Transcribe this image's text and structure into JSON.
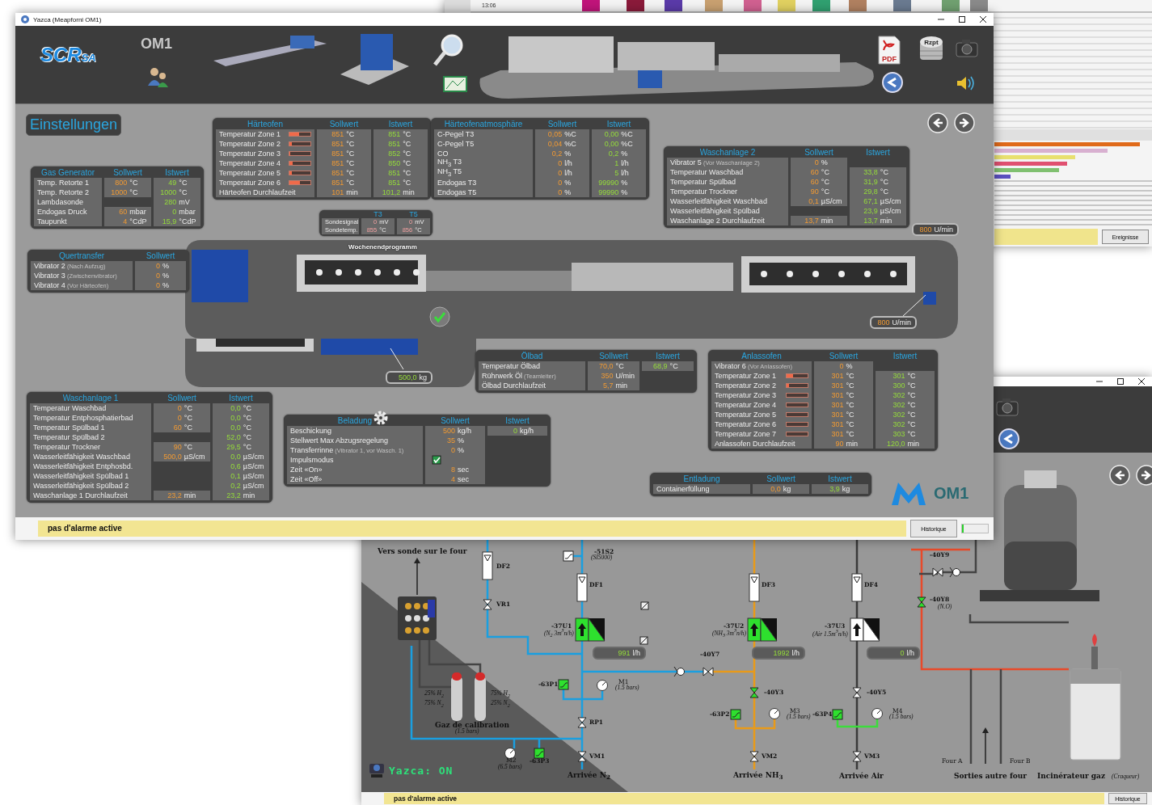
{
  "main_window": {
    "title": "Yazca (Meapforni OM1)",
    "header": {
      "logo": "SCR",
      "logo_suffix": "SA",
      "plant": "OM1",
      "pdf_label": "PDF",
      "database_label": "Rzpt"
    },
    "settings_button": "Einstellungen",
    "panels": [
      {
        "title": "Härteofen",
        "kind": "table",
        "columns": [
          "Sollwert",
          "Istwert"
        ],
        "rows": [
          {
            "label": "Temperatur Zone 1",
            "level": 0.45,
            "setpoint": {
              "value": "851",
              "unit": "°C"
            },
            "actual": {
              "value": "851",
              "unit": "°C"
            }
          },
          {
            "label": "Temperatur Zone 2",
            "level": 0.1,
            "setpoint": {
              "value": "851",
              "unit": "°C"
            },
            "actual": {
              "value": "851",
              "unit": "°C"
            }
          },
          {
            "label": "Temperatur Zone 3",
            "level": 0.03,
            "setpoint": {
              "value": "851",
              "unit": "°C"
            },
            "actual": {
              "value": "852",
              "unit": "°C"
            }
          },
          {
            "label": "Temperatur Zone 4",
            "level": 0.15,
            "setpoint": {
              "value": "851",
              "unit": "°C"
            },
            "actual": {
              "value": "850",
              "unit": "°C"
            }
          },
          {
            "label": "Temperatur Zone 5",
            "level": 0.1,
            "setpoint": {
              "value": "851",
              "unit": "°C"
            },
            "actual": {
              "value": "851",
              "unit": "°C"
            }
          },
          {
            "label": "Temperatur Zone 6",
            "level": 0.5,
            "setpoint": {
              "value": "851",
              "unit": "°C"
            },
            "actual": {
              "value": "851",
              "unit": "°C"
            }
          },
          {
            "label": "Härteofen Durchlaufzeit",
            "setpoint": {
              "value": "101",
              "unit": "min"
            },
            "actual": {
              "value": "101,2",
              "unit": "min"
            }
          }
        ]
      },
      {
        "title": "Härteofenatmosphäre",
        "kind": "table",
        "columns": [
          "Sollwert",
          "Istwert"
        ],
        "rows": [
          {
            "label": "C-Pegel T3",
            "setpoint": {
              "value": "0,05",
              "unit": "%C"
            },
            "actual": {
              "value": "0,00",
              "unit": "%C"
            }
          },
          {
            "label": "C-Pegel T5",
            "setpoint": {
              "value": "0,04",
              "unit": "%C"
            },
            "actual": {
              "value": "0,00",
              "unit": "%C"
            }
          },
          {
            "label": "CO",
            "setpoint": {
              "value": "0,2",
              "unit": "%"
            },
            "actual": {
              "value": "0,2",
              "unit": "%"
            }
          },
          {
            "label": "NH$_{3}$ T3",
            "setpoint": {
              "value": "0",
              "unit": "l/h"
            },
            "actual": {
              "value": "1",
              "unit": "l/h"
            }
          },
          {
            "label": "NH$_{3}$ T5",
            "setpoint": {
              "value": "0",
              "unit": "l/h"
            },
            "actual": {
              "value": "5",
              "unit": "l/h"
            }
          },
          {
            "label": "Endogas T3",
            "setpoint": {
              "value": "0",
              "unit": "%"
            },
            "actual": {
              "value": "99990",
              "unit": "%"
            }
          },
          {
            "label": "Endogas T5",
            "setpoint": {
              "value": "0",
              "unit": "%"
            },
            "actual": {
              "value": "99990",
              "unit": "%"
            }
          }
        ]
      },
      {
        "title": "Gas Generator",
        "kind": "table",
        "columns": [
          "Sollwert",
          "Istwert"
        ],
        "rows": [
          {
            "label": "Temp. Retorte 1",
            "setpoint": {
              "value": "800",
              "unit": "°C"
            },
            "actual": {
              "value": "49",
              "unit": "°C"
            }
          },
          {
            "label": "Temp. Retorte 2",
            "setpoint": {
              "value": "1000",
              "unit": "°C"
            },
            "actual": {
              "value": "1000",
              "unit": "°C"
            }
          },
          {
            "label": "Lambdasonde",
            "actual": {
              "value": "280",
              "unit": "mV"
            }
          },
          {
            "label": "Endogas Druck",
            "setpoint": {
              "value": "60",
              "unit": "mbar"
            },
            "actual": {
              "value": "0",
              "unit": "mbar"
            }
          },
          {
            "label": "Taupunkt",
            "setpoint": {
              "value": "4",
              "unit": "°CdP"
            },
            "actual": {
              "value": "15,9",
              "unit": "°CdP"
            }
          }
        ]
      },
      {
        "title": "Waschanlage 2",
        "kind": "table",
        "columns": [
          "Sollwert",
          "Istwert"
        ],
        "rows": [
          {
            "label": "Vibrator 5",
            "note": "(Vor Waschanlage 2)",
            "setpoint": {
              "value": "0",
              "unit": "%"
            }
          },
          {
            "label": "Temperatur Waschbad",
            "setpoint": {
              "value": "60",
              "unit": "°C"
            },
            "actual": {
              "value": "33,8",
              "unit": "°C"
            }
          },
          {
            "label": "Temperatur Spülbad",
            "setpoint": {
              "value": "60",
              "unit": "°C"
            },
            "actual": {
              "value": "31,9",
              "unit": "°C"
            }
          },
          {
            "label": "Temperatur Trockner",
            "setpoint": {
              "value": "90",
              "unit": "°C"
            },
            "actual": {
              "value": "29,8",
              "unit": "°C"
            }
          },
          {
            "label": "Wasserleitfähigkeit Waschbad",
            "setpoint": {
              "value": "0,1",
              "unit": "µS/cm"
            },
            "actual": {
              "value": "67,1",
              "unit": "µS/cm"
            }
          },
          {
            "label": "Wasserleitfähigkeit Spülbad",
            "actual": {
              "value": "23,9",
              "unit": "µS/cm"
            }
          },
          {
            "label": "Waschanlage 2 Durchlaufzeit",
            "setpoint": {
              "value": "13,7",
              "unit": "min"
            },
            "actual": {
              "value": "13,7",
              "unit": "min"
            }
          }
        ]
      },
      {
        "kind": "probe",
        "columns": [
          "T3",
          "T5"
        ],
        "rows": [
          {
            "label": "Sondesignal",
            "t3": {
              "value": "0",
              "unit": "mV"
            },
            "t5": {
              "value": "0",
              "unit": "mV"
            }
          },
          {
            "label": "Sondetemp.",
            "t3": {
              "value": "855",
              "unit": "°C"
            },
            "t5": {
              "value": "856",
              "unit": "°C"
            }
          }
        ]
      },
      {
        "title": "Quertransfer",
        "kind": "table",
        "columns": [
          "Sollwert"
        ],
        "rows": [
          {
            "label": "Vibrator 2",
            "note": "(Nach Aufzug)",
            "setpoint": {
              "value": "0",
              "unit": "%"
            }
          },
          {
            "label": "Vibrator 3",
            "note": "(Zwischenvibrator)",
            "setpoint": {
              "value": "0",
              "unit": "%"
            }
          },
          {
            "label": "Vibrator 4",
            "note": "(Vor Härteofen)",
            "setpoint": {
              "value": "0",
              "unit": "%"
            }
          }
        ]
      },
      {
        "title": "Ölbad",
        "kind": "table",
        "columns": [
          "Sollwert",
          "Istwert"
        ],
        "rows": [
          {
            "label": "Temperatur Ölbad",
            "setpoint": {
              "value": "70,0",
              "unit": "°C"
            },
            "actual": {
              "value": "68,9",
              "unit": "°C"
            }
          },
          {
            "label": "Rührwerk Öl",
            "note": "(Teamleiter)",
            "setpoint": {
              "value": "350",
              "unit": "U/min"
            }
          },
          {
            "label": "Ölbad Durchlaufzeit",
            "setpoint": {
              "value": "5,7",
              "unit": "min"
            }
          }
        ]
      },
      {
        "title": "Anlassofen",
        "kind": "table",
        "columns": [
          "Sollwert",
          "Istwert"
        ],
        "rows": [
          {
            "label": "Vibrator 6",
            "note": "(Vor Anlassofen)",
            "setpoint": {
              "value": "0",
              "unit": "%"
            }
          },
          {
            "label": "Temperatur Zone 1",
            "level": 0.3,
            "setpoint": {
              "value": "301",
              "unit": "°C"
            },
            "actual": {
              "value": "301",
              "unit": "°C"
            }
          },
          {
            "label": "Temperatur Zone 2",
            "level": 0.12,
            "setpoint": {
              "value": "301",
              "unit": "°C"
            },
            "actual": {
              "value": "300",
              "unit": "°C"
            }
          },
          {
            "label": "Temperatur Zone 3",
            "level": 0,
            "setpoint": {
              "value": "301",
              "unit": "°C"
            },
            "actual": {
              "value": "302",
              "unit": "°C"
            }
          },
          {
            "label": "Temperatur Zone 4",
            "level": 0,
            "setpoint": {
              "value": "301",
              "unit": "°C"
            },
            "actual": {
              "value": "302",
              "unit": "°C"
            }
          },
          {
            "label": "Temperatur Zone 5",
            "level": 0,
            "setpoint": {
              "value": "301",
              "unit": "°C"
            },
            "actual": {
              "value": "302",
              "unit": "°C"
            }
          },
          {
            "label": "Temperatur Zone 6",
            "level": 0,
            "setpoint": {
              "value": "301",
              "unit": "°C"
            },
            "actual": {
              "value": "302",
              "unit": "°C"
            }
          },
          {
            "label": "Temperatur Zone 7",
            "level": 0,
            "setpoint": {
              "value": "301",
              "unit": "°C"
            },
            "actual": {
              "value": "303",
              "unit": "°C"
            }
          },
          {
            "label": "Anlassofen Durchlaufzeit",
            "setpoint": {
              "value": "90",
              "unit": "min"
            },
            "actual": {
              "value": "120,0",
              "unit": "min"
            }
          }
        ]
      },
      {
        "title": "Waschanlage 1",
        "kind": "table",
        "columns": [
          "Sollwert",
          "Istwert"
        ],
        "rows": [
          {
            "label": "Temperatur Waschbad",
            "setpoint": {
              "value": "0",
              "unit": "°C"
            },
            "actual": {
              "value": "0,0",
              "unit": "°C"
            }
          },
          {
            "label": "Temperatur Entphosphatierbad",
            "setpoint": {
              "value": "0",
              "unit": "°C"
            },
            "actual": {
              "value": "0,0",
              "unit": "°C"
            }
          },
          {
            "label": "Temperatur Spülbad 1",
            "setpoint": {
              "value": "60",
              "unit": "°C"
            },
            "actual": {
              "value": "0,0",
              "unit": "°C"
            }
          },
          {
            "label": "Temperatur Spülbad 2",
            "actual": {
              "value": "52,0",
              "unit": "°C"
            }
          },
          {
            "label": "Temperatur Trockner",
            "setpoint": {
              "value": "90",
              "unit": "°C"
            },
            "actual": {
              "value": "29,5",
              "unit": "°C"
            }
          },
          {
            "label": "Wasserleitfähigkeit Waschbad",
            "setpoint": {
              "value": "500,0",
              "unit": "µS/cm"
            },
            "actual": {
              "value": "0,0",
              "unit": "µS/cm"
            }
          },
          {
            "label": "Wasserleitfähigkeit Entphosbd.",
            "actual": {
              "value": "0,6",
              "unit": "µS/cm"
            }
          },
          {
            "label": "Wasserleitfähigkeit Spülbad 1",
            "actual": {
              "value": "0,1",
              "unit": "µS/cm"
            }
          },
          {
            "label": "Wasserleitfähigkeit Spülbad 2",
            "actual": {
              "value": "0,2",
              "unit": "µS/cm"
            }
          },
          {
            "label": "Waschanlage 1 Durchlaufzeit",
            "setpoint": {
              "value": "23,2",
              "unit": "min"
            },
            "actual": {
              "value": "23,2",
              "unit": "min"
            }
          }
        ]
      },
      {
        "title": "Beladung",
        "kind": "table",
        "columns": [
          "Sollwert",
          "Istwert"
        ],
        "rows": [
          {
            "label": "Beschickung",
            "kind": "value",
            "setpoint": {
              "value": "500",
              "unit": "kg/h"
            },
            "actual": {
              "value": "0",
              "unit": "kg/h"
            }
          },
          {
            "label": "Stellwert Max Abzugsregelung",
            "kind": "value",
            "setpoint": {
              "value": "35",
              "unit": "%"
            }
          },
          {
            "label": "Transferrinne",
            "kind": "value",
            "note": "(Vibrator 1, vor Wasch. 1)",
            "setpoint": {
              "value": "0",
              "unit": "%"
            }
          },
          {
            "label": "Impulsmodus",
            "kind": "checkbox",
            "checked": true
          },
          {
            "label": "Zeit «On»",
            "kind": "value",
            "setpoint": {
              "value": "8",
              "unit": "sec"
            }
          },
          {
            "label": "Zeit «Off»",
            "kind": "value",
            "setpoint": {
              "value": "4",
              "unit": "sec"
            }
          }
        ]
      },
      {
        "title": "Entladung",
        "kind": "table",
        "columns": [
          "Sollwert",
          "Istwert"
        ],
        "rows": [
          {
            "label": "Containerfüllung",
            "setpoint": {
              "value": "0,0",
              "unit": "kg"
            },
            "actual": {
              "value": "3,9",
              "unit": "kg"
            }
          }
        ]
      }
    ],
    "machine": {
      "program": "Wochenendprogramm",
      "readouts": [
        {
          "value": "800",
          "unit": "U/min",
          "kind": "setpoint"
        },
        {
          "value": "800",
          "unit": "U/min",
          "kind": "setpoint"
        },
        {
          "value": "500,0",
          "unit": "kg",
          "kind": "actual"
        }
      ]
    },
    "footer_logo": "OM1",
    "status": "pas d'alarme active",
    "history_button": "Historique",
    "progress": {
      "level": 0.06
    }
  },
  "back_window": {
    "time_label": "13:06",
    "button": "Ereignisse"
  },
  "diagram_window": {
    "labels": [
      {
        "text": "Vers sonde sur le four",
        "kind": "title"
      },
      {
        "text": "DF2",
        "kind": "tag"
      },
      {
        "text": "VR1",
        "kind": "tag"
      },
      {
        "text": "-51S2",
        "kind": "tag"
      },
      {
        "text": "(SI5000)",
        "kind": "note"
      },
      {
        "text": "DF1",
        "kind": "tag"
      },
      {
        "text": "DF3",
        "kind": "tag"
      },
      {
        "text": "DF4",
        "kind": "tag"
      },
      {
        "text": "-37U1",
        "kind": "tag"
      },
      {
        "text": "(N$_{2}$ 3m$^{3}$n/h)",
        "kind": "note"
      },
      {
        "text": "-37U2",
        "kind": "tag"
      },
      {
        "text": "(NH$_{3}$ 3m$^{3}$n/h)",
        "kind": "note"
      },
      {
        "text": "-37U3",
        "kind": "tag"
      },
      {
        "text": "(Air 1.5m$^{3}$n/h)",
        "kind": "note"
      },
      {
        "text": "-40Y7",
        "kind": "tag"
      },
      {
        "text": "-63P1",
        "kind": "tag"
      },
      {
        "text": "M1",
        "kind": "plain"
      },
      {
        "text": "(1.5 bars)",
        "kind": "note"
      },
      {
        "text": "-40Y3",
        "kind": "tag"
      },
      {
        "text": "-40Y5",
        "kind": "tag"
      },
      {
        "text": "-63P2",
        "kind": "tag"
      },
      {
        "text": "M3",
        "kind": "plain"
      },
      {
        "text": "(1.5 bars)",
        "kind": "note"
      },
      {
        "text": "-63P4",
        "kind": "tag"
      },
      {
        "text": "M4",
        "kind": "plain"
      },
      {
        "text": "(1.5 bars)",
        "kind": "note"
      },
      {
        "text": "25% H$_{2}$",
        "kind": "note"
      },
      {
        "text": "75% N$_{2}$",
        "kind": "note"
      },
      {
        "text": "75% H$_{2}$",
        "kind": "note"
      },
      {
        "text": "25% N$_{2}$",
        "kind": "note"
      },
      {
        "text": "RP1",
        "kind": "tag"
      },
      {
        "text": "Gaz de calibration",
        "kind": "title"
      },
      {
        "text": "(1.5 bars)",
        "kind": "note"
      },
      {
        "text": "M2",
        "kind": "plain"
      },
      {
        "text": "(6.5 bars)",
        "kind": "note"
      },
      {
        "text": "-63P3",
        "kind": "tag"
      },
      {
        "text": "VM1",
        "kind": "tag"
      },
      {
        "text": "VM2",
        "kind": "tag"
      },
      {
        "text": "VM3",
        "kind": "tag"
      },
      {
        "text": "Arrivée N$_{2}$",
        "kind": "title"
      },
      {
        "text": "Arrivée NH$_{3}$",
        "kind": "title"
      },
      {
        "text": "Arrivée Air",
        "kind": "title"
      },
      {
        "text": "-40Y9",
        "kind": "tag"
      },
      {
        "text": "-40Y8",
        "kind": "tag"
      },
      {
        "text": "(N.O)",
        "kind": "note"
      },
      {
        "text": "Four A",
        "kind": "plain"
      },
      {
        "text": "Four B",
        "kind": "plain"
      },
      {
        "text": "Sorties autre four",
        "kind": "title"
      },
      {
        "text": "Incinérateur gaz",
        "kind": "title"
      },
      {
        "text": "(Craqueur)",
        "kind": "note"
      }
    ],
    "readouts": [
      {
        "value": "991",
        "unit": "l/h"
      },
      {
        "value": "1992",
        "unit": "l/h"
      },
      {
        "value": "0",
        "unit": "l/h"
      }
    ],
    "brand": "Yazca: ON",
    "status": "pas d'alarme active",
    "history_button": "Historique"
  }
}
